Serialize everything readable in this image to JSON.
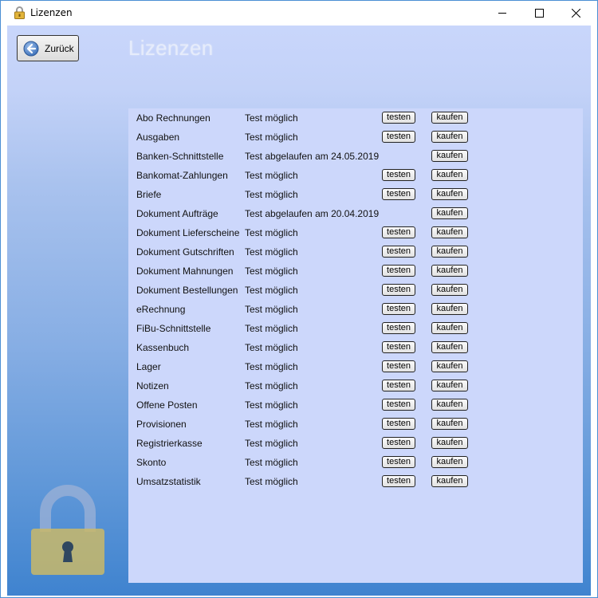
{
  "window": {
    "title": "Lizenzen",
    "icon": "padlock-icon",
    "controls": [
      "minimize-icon",
      "maximize-icon",
      "close-icon"
    ]
  },
  "toolbar": {
    "back_label": "Zurück",
    "back_icon": "arrow-left-circle-icon"
  },
  "page_title": "Lizenzen",
  "licenses": [
    {
      "name": "Abo Rechnungen",
      "status": "Test möglich",
      "test_label": "testen",
      "buy_label": "kaufen"
    },
    {
      "name": "Ausgaben",
      "status": "Test möglich",
      "test_label": "testen",
      "buy_label": "kaufen"
    },
    {
      "name": "Banken-Schnittstelle",
      "status": "Test abgelaufen am 24.05.2019",
      "test_label": null,
      "buy_label": "kaufen"
    },
    {
      "name": "Bankomat-Zahlungen",
      "status": "Test möglich",
      "test_label": "testen",
      "buy_label": "kaufen"
    },
    {
      "name": "Briefe",
      "status": "Test möglich",
      "test_label": "testen",
      "buy_label": "kaufen"
    },
    {
      "name": "Dokument Aufträge",
      "status": "Test abgelaufen am 20.04.2019",
      "test_label": null,
      "buy_label": "kaufen"
    },
    {
      "name": "Dokument Lieferscheine",
      "status": "Test möglich",
      "test_label": "testen",
      "buy_label": "kaufen"
    },
    {
      "name": "Dokument Gutschriften",
      "status": "Test möglich",
      "test_label": "testen",
      "buy_label": "kaufen"
    },
    {
      "name": "Dokument Mahnungen",
      "status": "Test möglich",
      "test_label": "testen",
      "buy_label": "kaufen"
    },
    {
      "name": "Dokument Bestellungen",
      "status": "Test möglich",
      "test_label": "testen",
      "buy_label": "kaufen"
    },
    {
      "name": "eRechnung",
      "status": "Test möglich",
      "test_label": "testen",
      "buy_label": "kaufen"
    },
    {
      "name": "FiBu-Schnittstelle",
      "status": "Test möglich",
      "test_label": "testen",
      "buy_label": "kaufen"
    },
    {
      "name": "Kassenbuch",
      "status": "Test möglich",
      "test_label": "testen",
      "buy_label": "kaufen"
    },
    {
      "name": "Lager",
      "status": "Test möglich",
      "test_label": "testen",
      "buy_label": "kaufen"
    },
    {
      "name": "Notizen",
      "status": "Test möglich",
      "test_label": "testen",
      "buy_label": "kaufen"
    },
    {
      "name": "Offene Posten",
      "status": "Test möglich",
      "test_label": "testen",
      "buy_label": "kaufen"
    },
    {
      "name": "Provisionen",
      "status": "Test möglich",
      "test_label": "testen",
      "buy_label": "kaufen"
    },
    {
      "name": "Registrierkasse",
      "status": "Test möglich",
      "test_label": "testen",
      "buy_label": "kaufen"
    },
    {
      "name": "Skonto",
      "status": "Test möglich",
      "test_label": "testen",
      "buy_label": "kaufen"
    },
    {
      "name": "Umsatzstatistik",
      "status": "Test möglich",
      "test_label": "testen",
      "buy_label": "kaufen"
    }
  ],
  "decorations": {
    "watermark_icon": "padlock-watermark-icon"
  }
}
